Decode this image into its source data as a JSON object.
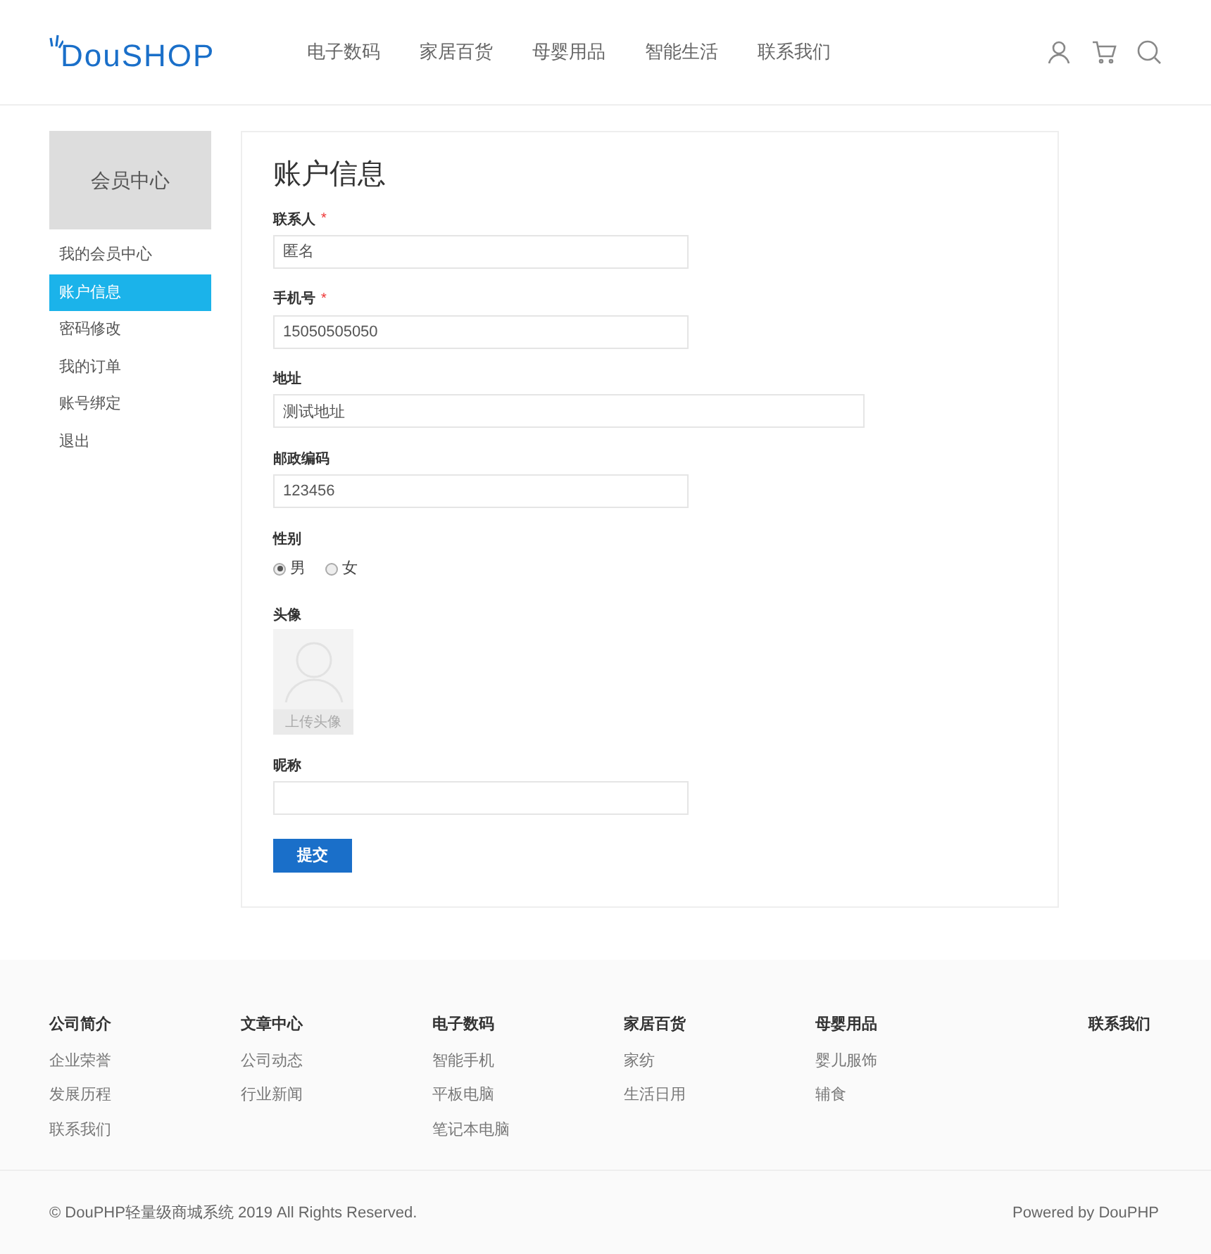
{
  "header": {
    "logo": "DouSHOP",
    "nav": [
      "电子数码",
      "家居百货",
      "母婴用品",
      "智能生活",
      "联系我们"
    ]
  },
  "sidebar": {
    "title": "会员中心",
    "items": [
      {
        "label": "我的会员中心",
        "selected": false
      },
      {
        "label": "账户信息",
        "selected": true
      },
      {
        "label": "密码修改",
        "selected": false
      },
      {
        "label": "我的订单",
        "selected": false
      },
      {
        "label": "账号绑定",
        "selected": false
      },
      {
        "label": "退出",
        "selected": false
      }
    ]
  },
  "form": {
    "title": "账户信息",
    "fields": [
      {
        "kind": "text",
        "label": "联系人",
        "required_mark": "*",
        "wide": false,
        "value": "匿名"
      },
      {
        "kind": "text",
        "label": "手机号",
        "required_mark": "*",
        "wide": false,
        "value": "15050505050"
      },
      {
        "kind": "text",
        "label": "地址",
        "wide": true,
        "value": "测试地址"
      },
      {
        "kind": "text",
        "label": "邮政编码",
        "wide": false,
        "value": "123456"
      },
      {
        "kind": "radio",
        "label": "性别",
        "options": [
          {
            "label": "男",
            "selected": true
          },
          {
            "label": "女",
            "selected": false
          }
        ]
      },
      {
        "kind": "avatar",
        "label": "头像",
        "caption": "上传头像"
      },
      {
        "kind": "text",
        "label": "昵称",
        "wide": false
      }
    ],
    "submit": "提交"
  },
  "footer": {
    "columns": [
      {
        "title": "公司简介",
        "links": [
          "企业荣誉",
          "发展历程",
          "联系我们"
        ]
      },
      {
        "title": "文章中心",
        "links": [
          "公司动态",
          "行业新闻"
        ]
      },
      {
        "title": "电子数码",
        "links": [
          "智能手机",
          "平板电脑",
          "笔记本电脑"
        ]
      },
      {
        "title": "家居百货",
        "links": [
          "家纺",
          "生活日用"
        ]
      },
      {
        "title": "母婴用品",
        "links": [
          "婴儿服饰",
          "辅食"
        ]
      }
    ],
    "contact": "联系我们",
    "copyright": "© DouPHP轻量级商城系统 2019 All Rights Reserved.",
    "powered": "Powered by DouPHP"
  }
}
